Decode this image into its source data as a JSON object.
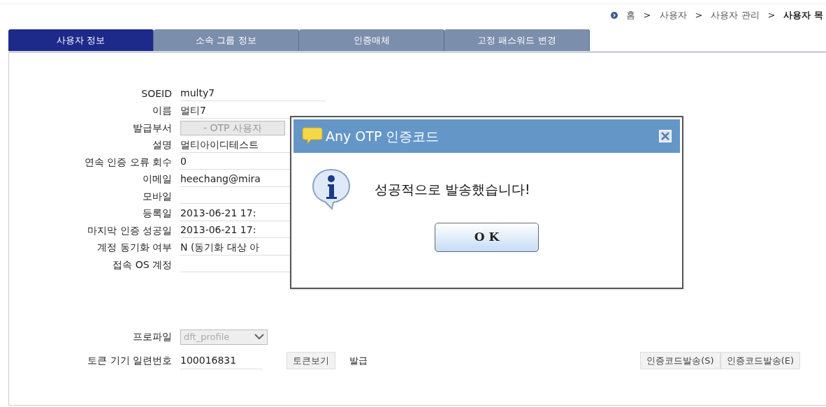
{
  "breadcrumb": [
    {
      "label": "홈",
      "current": false
    },
    {
      "label": "사용자",
      "current": false
    },
    {
      "label": "사용자 관리",
      "current": false
    },
    {
      "label": "사용자 목",
      "current": true
    }
  ],
  "breadcrumb_separator": ">",
  "tabs": [
    {
      "label": "사용자 정보",
      "selected": true
    },
    {
      "label": "소속 그룹 정보",
      "selected": false
    },
    {
      "label": "인증매체",
      "selected": false
    },
    {
      "label": "고정 패스워드 변경",
      "selected": false
    }
  ],
  "fields": [
    {
      "label": "SOEID",
      "kind": "text",
      "value": "multy7"
    },
    {
      "label": "이름",
      "kind": "text",
      "value": "멀티7"
    },
    {
      "label": "발급부서",
      "kind": "disabled",
      "value": "- OTP 사용자"
    },
    {
      "label": "설명",
      "kind": "text",
      "value": "멀티아이디테스트"
    },
    {
      "label": "연속 인증 오류 회수",
      "kind": "text",
      "value": "0"
    },
    {
      "label": "이메일",
      "kind": "text",
      "value": "heechang@mira"
    },
    {
      "label": "모바일",
      "kind": "text"
    },
    {
      "label": "등록일",
      "kind": "text",
      "value": "2013-06-21 17:"
    },
    {
      "label": "마지막 인증 성공일",
      "kind": "text",
      "value": "2013-06-21 17:"
    },
    {
      "label": "계정 동기화 여부",
      "kind": "text",
      "value": "N (동기화 대상 아"
    },
    {
      "label": "접속 OS 계정",
      "kind": "wide"
    }
  ],
  "profile": {
    "label": "프로파일",
    "value": "dft_profile",
    "disabled": true
  },
  "token": {
    "label": "토큰 기기 일련번호",
    "value": "100016831",
    "view_button": "토큰보기",
    "status": "발급"
  },
  "send_buttons": [
    "인증코드발송(S)",
    "인증코드발송(E)"
  ],
  "dialog": {
    "title": "Any OTP 인증코드",
    "message": "성공적으로 발송했습니다!",
    "button": "O K"
  }
}
